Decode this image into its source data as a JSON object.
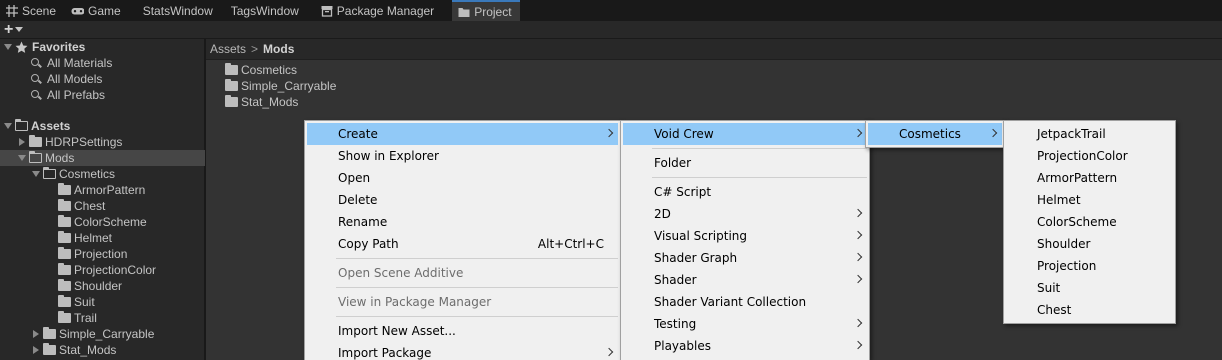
{
  "tabs": [
    {
      "label": "Scene",
      "icon": "grid-icon"
    },
    {
      "label": "Game",
      "icon": "gamepad-icon"
    },
    {
      "label": "StatsWindow",
      "icon": ""
    },
    {
      "label": "TagsWindow",
      "icon": ""
    },
    {
      "label": "Package Manager",
      "icon": "package-icon"
    },
    {
      "label": "Project",
      "icon": "folder-icon"
    }
  ],
  "toolbar": {
    "add": "+"
  },
  "favorites": {
    "title": "Favorites",
    "items": [
      "All Materials",
      "All Models",
      "All Prefabs"
    ]
  },
  "assets": {
    "title": "Assets",
    "tree": [
      "HDRPSettings",
      "Mods",
      "Cosmetics",
      "ArmorPattern",
      "Chest",
      "ColorScheme",
      "Helmet",
      "Projection",
      "ProjectionColor",
      "Shoulder",
      "Suit",
      "Trail",
      "Simple_Carryable",
      "Stat_Mods"
    ]
  },
  "breadcrumb": {
    "root": "Assets",
    "sep": ">",
    "current": "Mods"
  },
  "folder_contents": [
    "Cosmetics",
    "Simple_Carryable",
    "Stat_Mods"
  ],
  "menu1": {
    "items": [
      "Create",
      "Show in Explorer",
      "Open",
      "Delete",
      "Rename",
      "Copy Path",
      "Open Scene Additive",
      "View in Package Manager",
      "Import New Asset...",
      "Import Package"
    ],
    "copy_path_shortcut": "Alt+Ctrl+C"
  },
  "menu2": {
    "items": [
      "Void Crew",
      "Folder",
      "C# Script",
      "2D",
      "Visual Scripting",
      "Shader Graph",
      "Shader",
      "Shader Variant Collection",
      "Testing",
      "Playables"
    ]
  },
  "menu3": {
    "items": [
      "Cosmetics"
    ]
  },
  "menu4": {
    "items": [
      "JetpackTrail",
      "ProjectionColor",
      "ArmorPattern",
      "Helmet",
      "ColorScheme",
      "Shoulder",
      "Projection",
      "Suit",
      "Chest"
    ]
  },
  "colors": {
    "highlight": "#91c9f7",
    "menu_bg": "#f0f0f0",
    "tab_accent": "#3a79bb"
  }
}
